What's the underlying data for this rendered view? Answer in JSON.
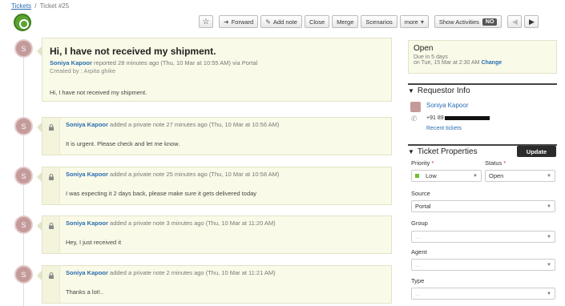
{
  "breadcrumb": {
    "root": "Tickets",
    "separator": "/",
    "current": "Ticket #25"
  },
  "toolbar": {
    "star": "☆",
    "forward": "Forward",
    "add_note": "Add note",
    "close": "Close",
    "merge": "Merge",
    "scenarios": "Scenarios",
    "more": "more",
    "show_activities": "Show Activities",
    "toggle_value": "NO",
    "prev": "◀",
    "next": "▶"
  },
  "avatar_letter": "S",
  "ticket": {
    "subject": "Hi, I have not received my shipment.",
    "requester": "Soniya Kapoor",
    "meta": "reported 28 minutes ago (Thu, 10 Mar at 10:55 AM) via Portal",
    "created_by": "Created by : Arpita ghike",
    "body": "Hi, I have not received my shipment."
  },
  "notes": [
    {
      "author": "Soniya Kapoor",
      "meta": "added a private note 27 minutes ago (Thu, 10 Mar at 10:56 AM)",
      "body": "It is urgent. Please check and let me know."
    },
    {
      "author": "Soniya Kapoor",
      "meta": "added a private note 25 minutes ago (Thu, 10 Mar at 10:58 AM)",
      "body": "I was expecting it 2 days back, please make sure it gets delivered today"
    },
    {
      "author": "Soniya Kapoor",
      "meta": "added a private note 3 minutes ago (Thu, 10 Mar at 11:20 AM)",
      "body": "Hey, I just received it"
    },
    {
      "author": "Soniya Kapoor",
      "meta": "added a private note 2 minutes ago (Thu, 10 Mar at 11:21 AM)",
      "body": "Thanks a lot!.."
    }
  ],
  "status_box": {
    "status": "Open",
    "due": "Due in 5 days",
    "due_date": "on Tue, 15 Mar at 2:30 AM",
    "change": "Change"
  },
  "requestor": {
    "title": "Requestor Info",
    "name": "Soniya Kapoor",
    "phone": "+91 89",
    "recent": "Recent tickets"
  },
  "properties": {
    "title": "Ticket Properties",
    "update": "Update",
    "priority_label": "Priority",
    "priority_value": "Low",
    "status_label": "Status",
    "status_value": "Open",
    "source_label": "Source",
    "source_value": "Portal",
    "group_label": "Group",
    "group_value": "...",
    "agent_label": "Agent",
    "agent_value": "...",
    "type_label": "Type",
    "type_value": "...",
    "required_mark": "*",
    "priority_color": "#6cbf2f"
  }
}
